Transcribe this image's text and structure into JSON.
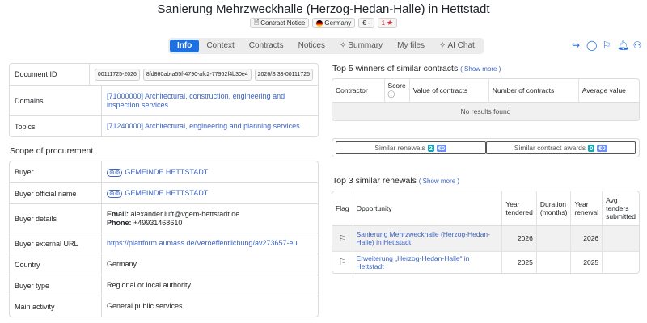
{
  "title": "Sanierung Mehrzweckhalle (Herzog-Hedan-Halle) in Hettstadt",
  "meta": {
    "notice_icon": "document-icon",
    "notice_label": "Contract Notice",
    "country_label": "Germany",
    "currency_label": "€ -",
    "count_label": "1"
  },
  "tabs": [
    {
      "label": "Info",
      "active": true
    },
    {
      "label": "Context"
    },
    {
      "label": "Contracts"
    },
    {
      "label": "Notices"
    },
    {
      "label": "Summary",
      "icon": "sparkle-icon"
    },
    {
      "label": "My files"
    },
    {
      "label": "AI Chat",
      "icon": "sparkle-icon"
    }
  ],
  "actions": [
    "share-icon",
    "comment-icon",
    "flag-icon",
    "bell-icon",
    "add-user-icon"
  ],
  "info": {
    "document_id_label": "Document ID",
    "document_ids": [
      "00111725-2026",
      "8fd860ab-a55f-4790-afc2-77962f4b30e4",
      "2026/S 33-00111725"
    ],
    "domains_label": "Domains",
    "domains_value": "[71000000] Architectural, construction, engineering and inspection services",
    "topics_label": "Topics",
    "topics_value": "[71240000] Architectural, engineering and planning services"
  },
  "scope": {
    "heading": "Scope of procurement",
    "buyer_label": "Buyer",
    "buyer_value": "GEMEINDE HETTSTADT",
    "buyer_official_label": "Buyer official name",
    "buyer_official_value": "GEMEINDE HETTSTADT",
    "buyer_details_label": "Buyer details",
    "email_label": "Email:",
    "email_value": "alexander.luft@vgem-hettstadt.de",
    "phone_label": "Phone:",
    "phone_value": "+49931468610",
    "url_label": "Buyer external URL",
    "url_value": "https://plattform.aumass.de/Veroeffentlichung/av273657-eu",
    "country_label": "Country",
    "country_value": "Germany",
    "buyer_type_label": "Buyer type",
    "buyer_type_value": "Regional or local authority",
    "main_activity_label": "Main activity",
    "main_activity_value": "General public services"
  },
  "winners": {
    "heading": "Top 5 winners of similar contracts",
    "show_more": "( Show more )",
    "columns": [
      "Contractor",
      "Score",
      "Value of contracts",
      "Number of contracts",
      "Average value"
    ],
    "empty_text": "No results found"
  },
  "similar": {
    "renewals_label": "Similar renewals",
    "renewals_count": "2",
    "renewals_value": "€0",
    "awards_label": "Similar contract awards",
    "awards_count": "0",
    "awards_value": "€0"
  },
  "renewals": {
    "heading": "Top 3 similar renewals",
    "show_more": "( Show more )",
    "columns": [
      "Flag",
      "Opportunity",
      "Year tendered",
      "Duration (months)",
      "Year renewal",
      "Avg tenders submitted"
    ],
    "rows": [
      {
        "opportunity": "Sanierung Mehrzweckhalle (Herzog-Hedan-Halle) in Hettstadt",
        "year_tendered": "2026",
        "duration": "",
        "year_renewal": "2026",
        "avg_tenders": ""
      },
      {
        "opportunity": "Erweiterung „Herzog-Hedan-Halle“ in Hettstadt",
        "year_tendered": "2025",
        "duration": "",
        "year_renewal": "2025",
        "avg_tenders": ""
      }
    ]
  },
  "colors": {
    "accent": "#1e6fe0",
    "link": "#3b63c4",
    "star": "#d9232d",
    "teal_badge": "#17a2b8",
    "blue_badge": "#6f8ff2"
  }
}
